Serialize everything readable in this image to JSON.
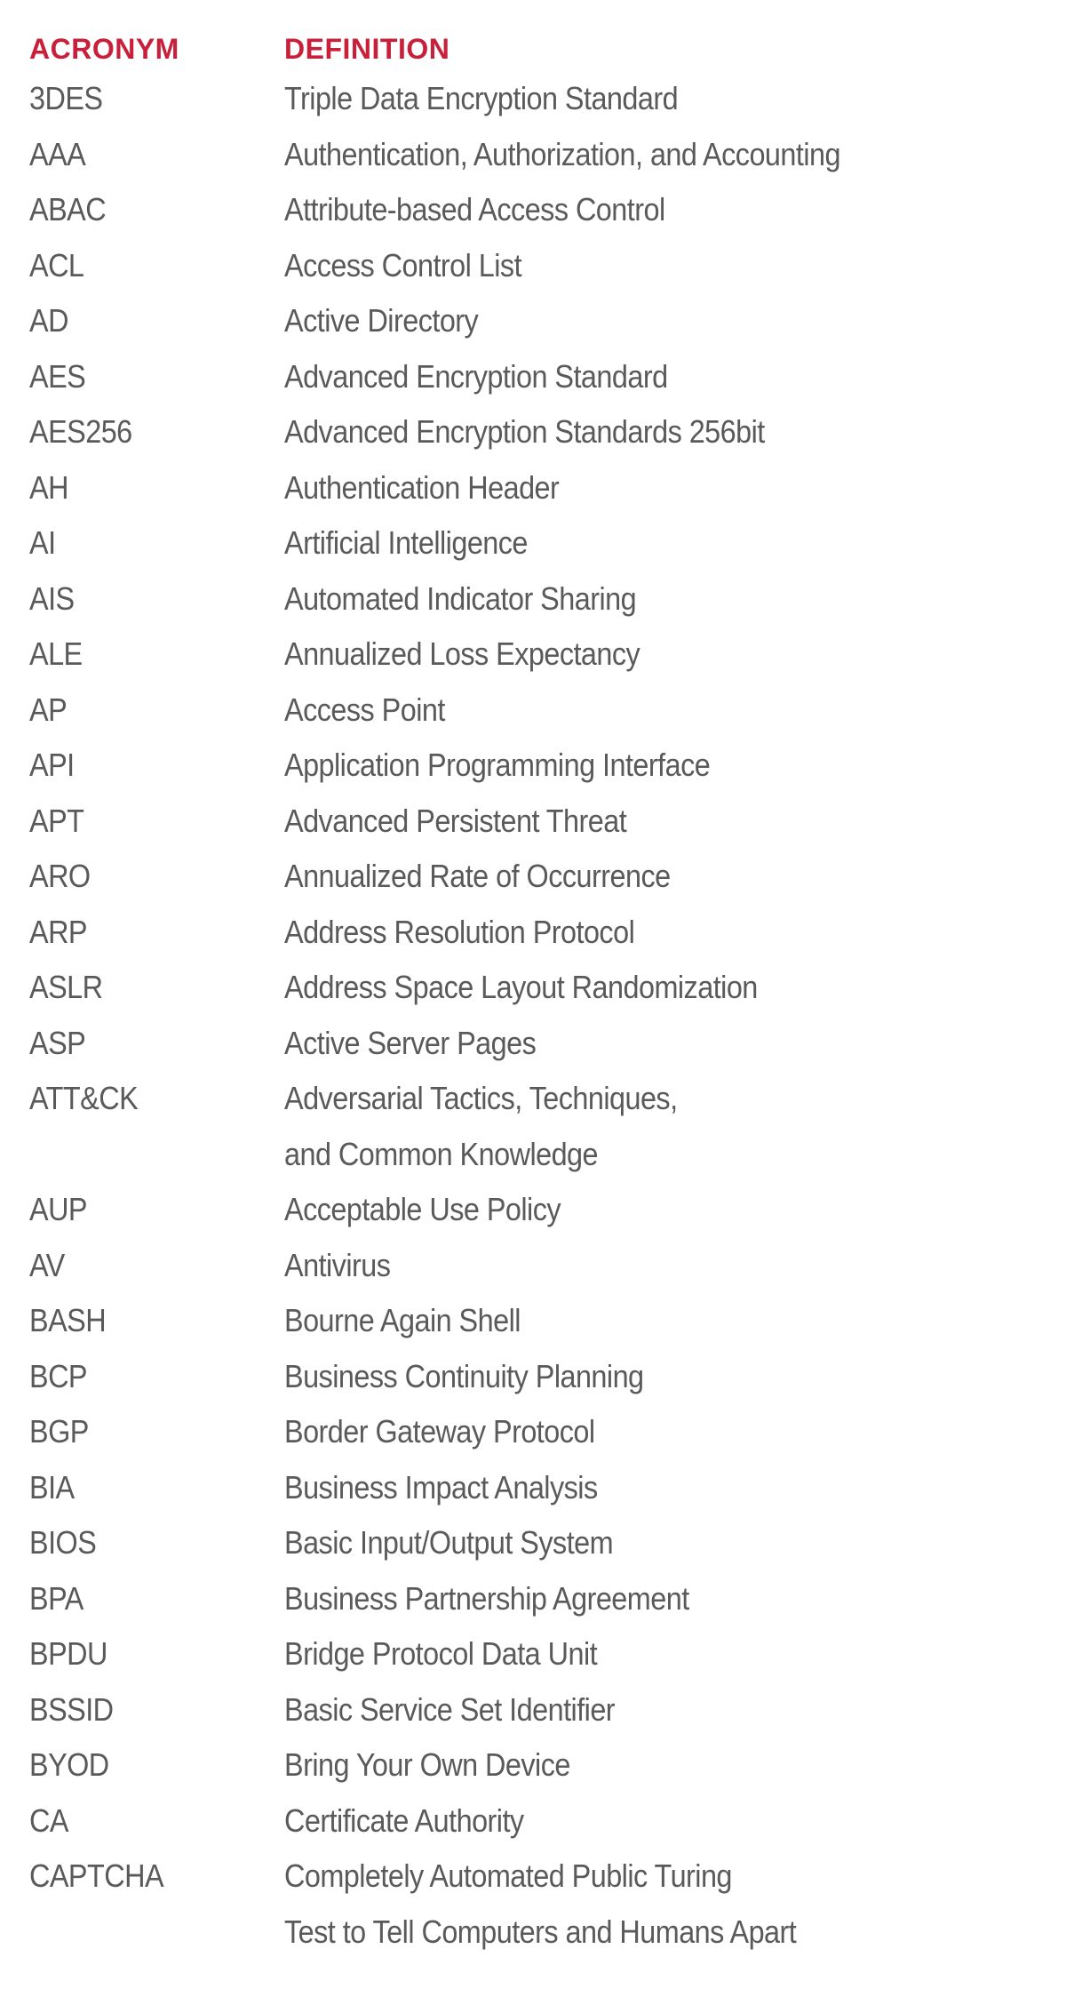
{
  "header": {
    "acronym_label": "ACRONYM",
    "definition_label": "DEFINITION"
  },
  "colors": {
    "header": "#c8203a",
    "text": "#5a5a5a"
  },
  "rows": [
    {
      "acronym": "3DES",
      "definition": [
        "Triple Data Encryption Standard"
      ]
    },
    {
      "acronym": "AAA",
      "definition": [
        "Authentication, Authorization, and Accounting"
      ]
    },
    {
      "acronym": "ABAC",
      "definition": [
        "Attribute-based Access Control"
      ]
    },
    {
      "acronym": "ACL",
      "definition": [
        "Access Control List"
      ]
    },
    {
      "acronym": "AD",
      "definition": [
        "Active Directory"
      ]
    },
    {
      "acronym": "AES",
      "definition": [
        "Advanced Encryption Standard"
      ]
    },
    {
      "acronym": "AES256",
      "definition": [
        "Advanced Encryption Standards 256bit"
      ]
    },
    {
      "acronym": "AH",
      "definition": [
        "Authentication Header"
      ]
    },
    {
      "acronym": "AI",
      "definition": [
        "Artificial Intelligence"
      ]
    },
    {
      "acronym": "AIS",
      "definition": [
        "Automated Indicator Sharing"
      ]
    },
    {
      "acronym": "ALE",
      "definition": [
        "Annualized Loss Expectancy"
      ]
    },
    {
      "acronym": "AP",
      "definition": [
        "Access Point"
      ]
    },
    {
      "acronym": "API",
      "definition": [
        "Application Programming Interface"
      ]
    },
    {
      "acronym": "APT",
      "definition": [
        "Advanced Persistent Threat"
      ]
    },
    {
      "acronym": "ARO",
      "definition": [
        "Annualized Rate of Occurrence"
      ]
    },
    {
      "acronym": "ARP",
      "definition": [
        "Address Resolution Protocol"
      ]
    },
    {
      "acronym": "ASLR",
      "definition": [
        "Address Space Layout Randomization"
      ]
    },
    {
      "acronym": "ASP",
      "definition": [
        "Active Server Pages"
      ]
    },
    {
      "acronym": "ATT&CK",
      "definition": [
        "Adversarial Tactics, Techniques,",
        "and Common Knowledge"
      ]
    },
    {
      "acronym": "AUP",
      "definition": [
        "Acceptable Use Policy"
      ]
    },
    {
      "acronym": "AV",
      "definition": [
        "Antivirus"
      ]
    },
    {
      "acronym": "BASH",
      "definition": [
        "Bourne Again Shell"
      ]
    },
    {
      "acronym": "BCP",
      "definition": [
        "Business Continuity Planning"
      ]
    },
    {
      "acronym": "BGP",
      "definition": [
        "Border Gateway Protocol"
      ]
    },
    {
      "acronym": "BIA",
      "definition": [
        "Business Impact Analysis"
      ]
    },
    {
      "acronym": "BIOS",
      "definition": [
        "Basic Input/Output System"
      ]
    },
    {
      "acronym": "BPA",
      "definition": [
        "Business Partnership Agreement"
      ]
    },
    {
      "acronym": "BPDU",
      "definition": [
        "Bridge Protocol Data Unit"
      ]
    },
    {
      "acronym": "BSSID",
      "definition": [
        "Basic Service Set Identifier"
      ]
    },
    {
      "acronym": "BYOD",
      "definition": [
        "Bring Your Own Device"
      ]
    },
    {
      "acronym": "CA",
      "definition": [
        "Certificate Authority"
      ]
    },
    {
      "acronym": "CAPTCHA",
      "definition": [
        "Completely Automated Public Turing",
        "Test to Tell Computers and Humans Apart"
      ]
    }
  ]
}
